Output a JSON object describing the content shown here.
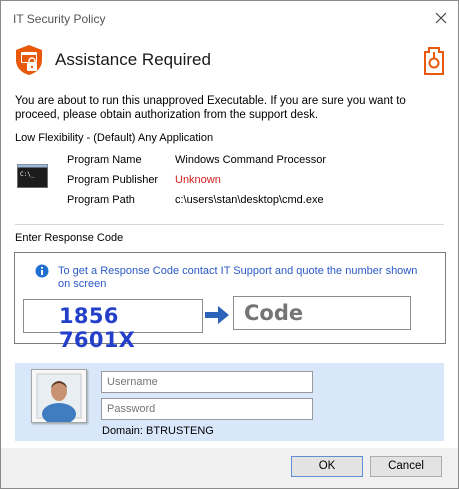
{
  "window": {
    "title": "IT Security Policy",
    "close_icon": "close-icon"
  },
  "header": {
    "title": "Assistance Required",
    "icon": "shield-lock-icon",
    "brand_icon": "brand-logo-icon",
    "accent": "#e8590c"
  },
  "intro": {
    "text": "You are about to run this unapproved Executable.  If you are sure you want to proceed, please obtain authorization from the support desk."
  },
  "flexibility": {
    "label": "Low Flexibility - (Default) Any Application"
  },
  "program": {
    "icon": "command-prompt-icon",
    "rows": [
      {
        "key": "Program Name",
        "value": "Windows Command Processor"
      },
      {
        "key": "Program Publisher",
        "value": "Unknown"
      },
      {
        "key": "Program Path",
        "value": "c:\\users\\stan\\desktop\\cmd.exe"
      }
    ],
    "unknown_color": "#d01e1e"
  },
  "response": {
    "label": "Enter Response Code",
    "info_icon": "info-icon",
    "info_text": "To get a Response Code contact IT Support and quote the number shown on screen",
    "challenge_code": "1856 7601X",
    "arrow_icon": "arrow-right-icon",
    "code_placeholder": "Code",
    "code_color": "#2440c8"
  },
  "login": {
    "avatar_icon": "user-avatar-icon",
    "username_placeholder": "Username",
    "password_placeholder": "Password",
    "domain": "Domain: BTRUSTENG",
    "panel_color": "#d9e7fb"
  },
  "footer": {
    "ok_label": "OK",
    "cancel_label": "Cancel"
  }
}
